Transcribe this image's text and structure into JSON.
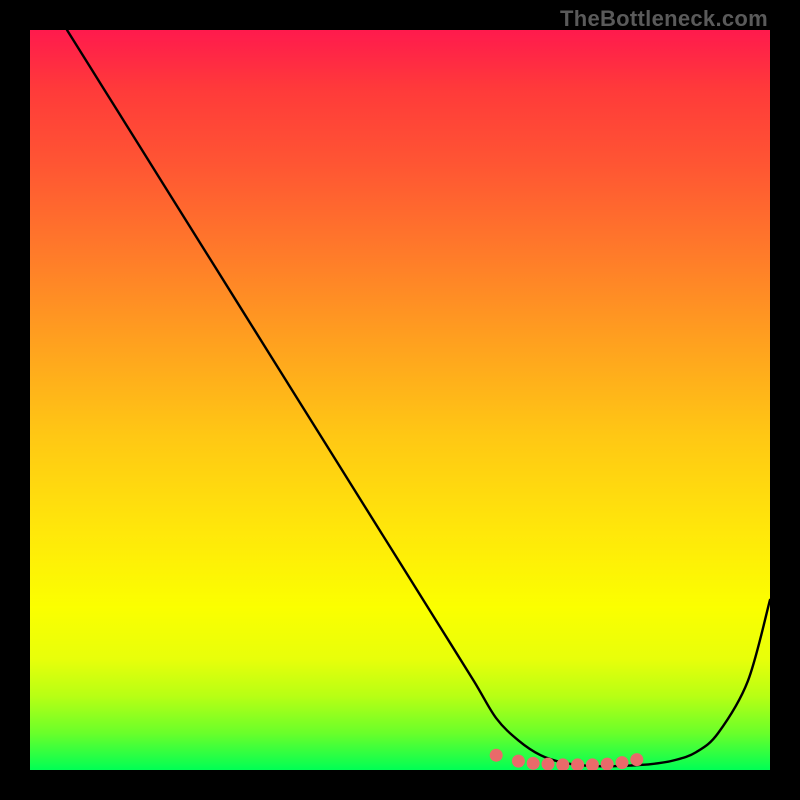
{
  "watermark": "TheBottleneck.com",
  "chart_data": {
    "type": "line",
    "title": "",
    "xlabel": "",
    "ylabel": "",
    "xlim": [
      0,
      100
    ],
    "ylim": [
      0,
      100
    ],
    "series": [
      {
        "name": "bottleneck-curve",
        "x": [
          5,
          10,
          15,
          20,
          25,
          30,
          35,
          40,
          45,
          50,
          55,
          60,
          63,
          66,
          69,
          72,
          75,
          78,
          81,
          84,
          87,
          90,
          93,
          97,
          100
        ],
        "y": [
          100,
          92,
          84,
          76,
          68,
          60,
          52,
          44,
          36,
          28,
          20,
          12,
          7,
          4,
          2,
          1,
          0.6,
          0.5,
          0.6,
          0.8,
          1.3,
          2.4,
          5,
          12,
          23
        ]
      }
    ],
    "markers": {
      "name": "highlight-dots",
      "color": "#e96a6a",
      "points_x": [
        63,
        66,
        68,
        70,
        72,
        74,
        76,
        78,
        80,
        82
      ],
      "points_y": [
        2.0,
        1.2,
        0.9,
        0.8,
        0.7,
        0.7,
        0.7,
        0.8,
        1.0,
        1.4
      ]
    },
    "gradient_stops": [
      {
        "pos": 0,
        "color": "#ff1a4d"
      },
      {
        "pos": 18,
        "color": "#ff5533"
      },
      {
        "pos": 42,
        "color": "#ffa01f"
      },
      {
        "pos": 68,
        "color": "#ffe80a"
      },
      {
        "pos": 90,
        "color": "#b8ff14"
      },
      {
        "pos": 100,
        "color": "#00ff55"
      }
    ]
  }
}
